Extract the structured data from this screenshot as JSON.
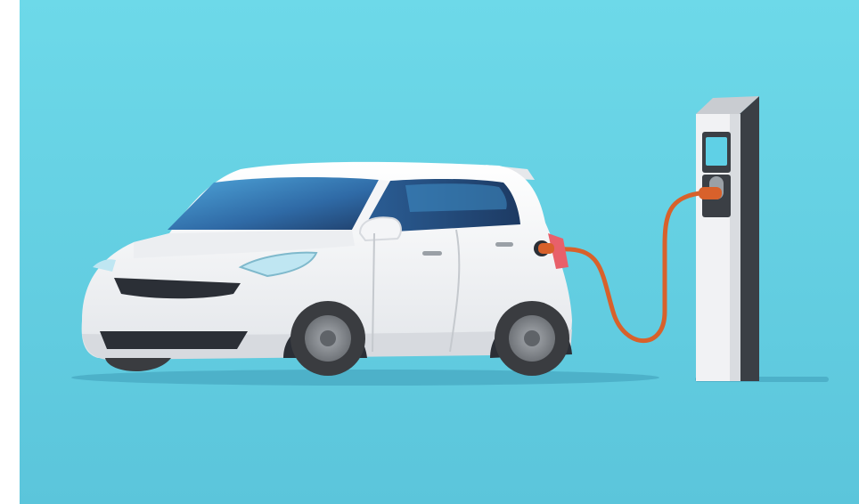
{
  "scene": {
    "subject": "electric-car-charging",
    "palette": {
      "background_top": "#6fd8e8",
      "background_bottom": "#5cc6dc",
      "car_body": "#f4f5f7",
      "car_shade": "#d7dadf",
      "window_dark": "#1f3f6b",
      "window_light": "#3f8fc8",
      "grille": "#2b2f36",
      "tire": "#3a3c40",
      "rim": "#8b8f95",
      "cable": "#d8612b",
      "taillight": "#e8606a",
      "station_body": "#f1f2f4",
      "station_side": "#3b3f45",
      "station_screen": "#5fd0e6",
      "shadow": "#48aac2"
    }
  }
}
